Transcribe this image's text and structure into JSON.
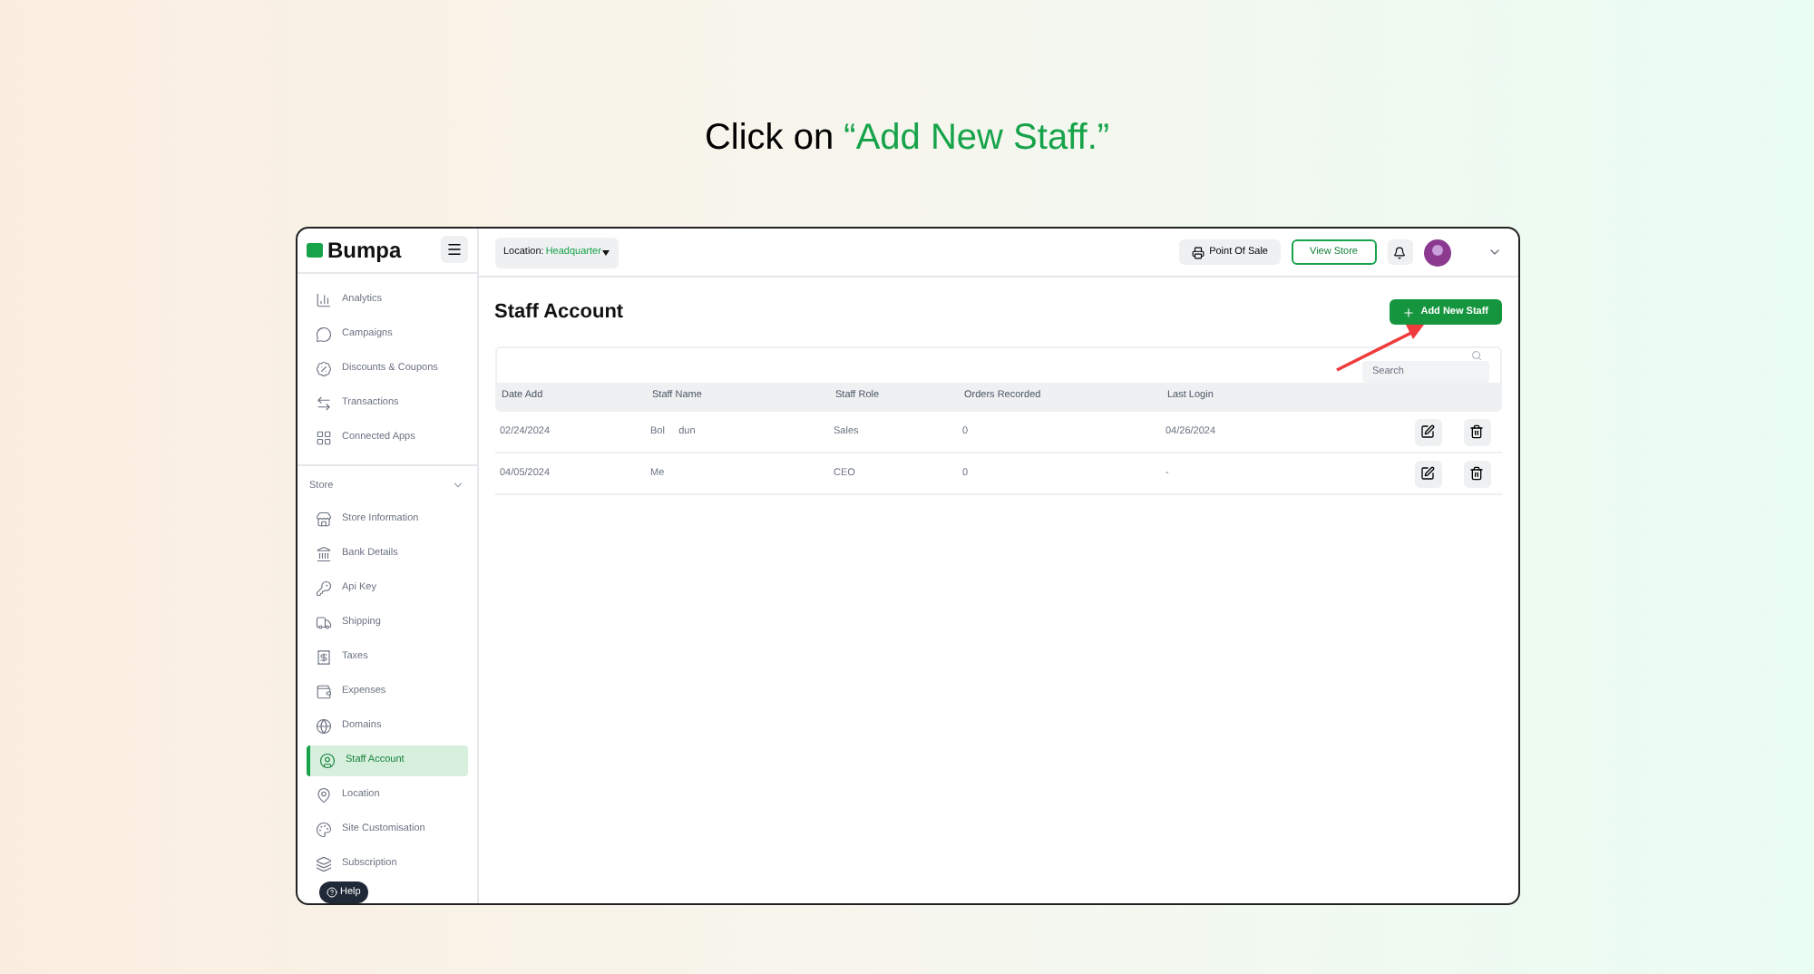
{
  "heading": {
    "prefix": "Click on ",
    "highlight": "“Add New Staff.”"
  },
  "app": {
    "logo": "Bumpa",
    "location": {
      "label": "Location:",
      "value": "Headquarter"
    },
    "point_of_sale": "Point Of Sale",
    "view_store": "View Store"
  },
  "sidebar": {
    "items": [
      {
        "label": "Analytics",
        "selected": false
      },
      {
        "label": "Campaigns",
        "selected": false
      },
      {
        "label": "Discounts & Coupons",
        "selected": false
      },
      {
        "label": "Transactions",
        "selected": false
      },
      {
        "label": "Connected Apps",
        "selected": false
      }
    ],
    "section": {
      "label": "Store",
      "expanded": true
    },
    "store_items": [
      {
        "label": "Store Information",
        "selected": false
      },
      {
        "label": "Bank Details",
        "selected": false
      },
      {
        "label": "Api Key",
        "selected": false
      },
      {
        "label": "Shipping",
        "selected": false
      },
      {
        "label": "Taxes",
        "selected": false
      },
      {
        "label": "Expenses",
        "selected": false
      },
      {
        "label": "Domains",
        "selected": false
      },
      {
        "label": "Staff Account",
        "selected": true
      },
      {
        "label": "Location",
        "selected": false
      },
      {
        "label": "Site Customisation",
        "selected": false
      },
      {
        "label": "Subscription",
        "selected": false
      }
    ],
    "help": "Help"
  },
  "page": {
    "title": "Staff Account",
    "add_button": "Add New Staff",
    "search": {
      "placeholder": "Search"
    }
  },
  "table": {
    "columns": [
      "Date Add",
      "Staff Name",
      "Staff Role",
      "Orders Recorded",
      "Last Login"
    ],
    "rows": [
      [
        "02/24/2024",
        "Bol     dun",
        "Sales",
        "0",
        "04/26/2024"
      ],
      [
        "04/05/2024",
        "Me",
        "CEO",
        "0",
        "-"
      ]
    ]
  }
}
